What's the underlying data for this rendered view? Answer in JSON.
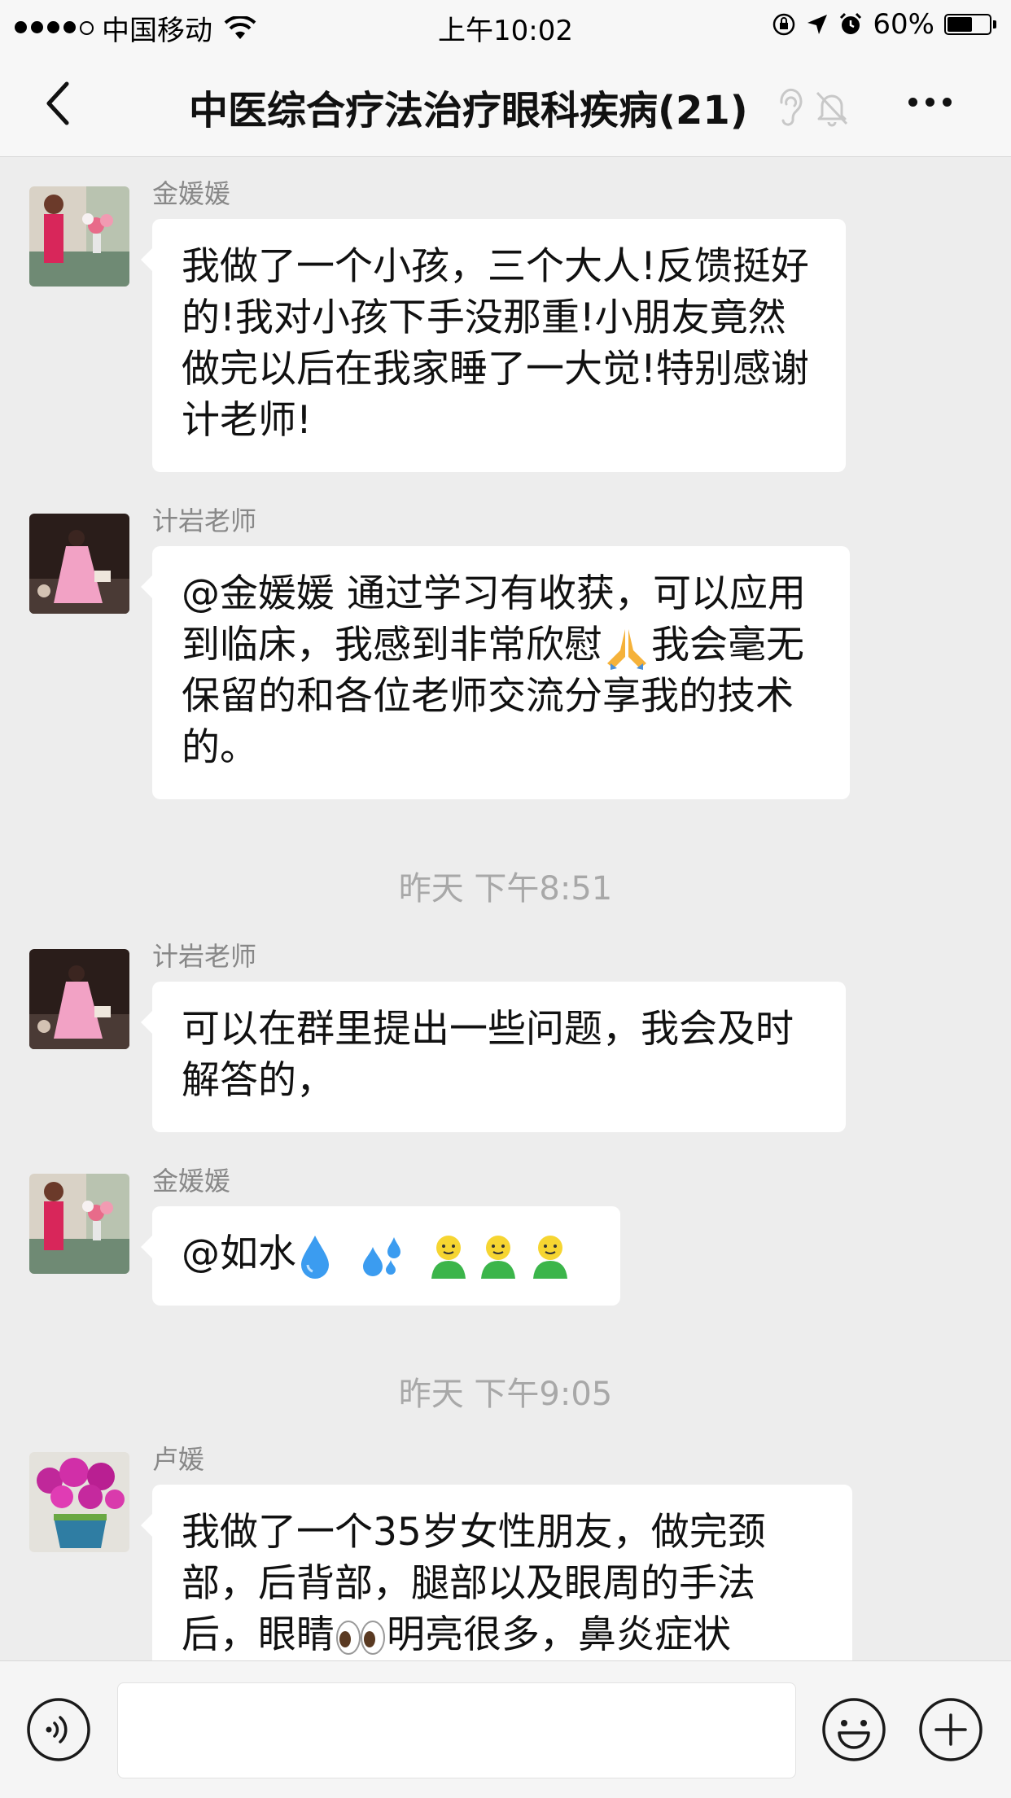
{
  "status_bar": {
    "carrier": "中国移动",
    "time": "上午10:02",
    "battery": "60%",
    "battery_level": 0.6
  },
  "nav": {
    "title": "中医综合疗法治疗眼科疾病(21)"
  },
  "messages": [
    {
      "sender": "金媛媛",
      "text": "我做了一个小孩，三个大人!反馈挺好的!我对小孩下手没那重!小朋友竟然做完以后在我家睡了一大觉!特别感谢计老师!"
    },
    {
      "sender": "计岩老师",
      "text_before": "@金媛媛 通过学习有收获，可以应用到临床，我感到非常欣慰",
      "text_after": "我会毫无保留的和各位老师交流分享我的技术的。"
    },
    {
      "sender": "计岩老师",
      "text": "可以在群里提出一些问题，我会及时解答的，"
    },
    {
      "sender": "金媛媛",
      "text": "@如水"
    },
    {
      "sender": "卢媛",
      "text_before": "我做了一个35岁女性朋友，做完颈部，后背部，腿部以及眼周的手法后，眼睛",
      "text_after": "明亮很多，鼻炎症状"
    }
  ],
  "timestamps": [
    "昨天 下午8:51",
    "昨天 下午9:05"
  ],
  "icons": {
    "back": "back-arrow-icon",
    "ear": "ear-icon",
    "mute": "bell-muted-icon",
    "more": "more-icon",
    "voice": "voice-icon",
    "emoji": "emoji-icon",
    "plus": "plus-icon"
  },
  "colors": {
    "background": "#ededed",
    "bubble": "#ffffff",
    "timestamp": "#a8a8a8",
    "sender": "#888888"
  }
}
